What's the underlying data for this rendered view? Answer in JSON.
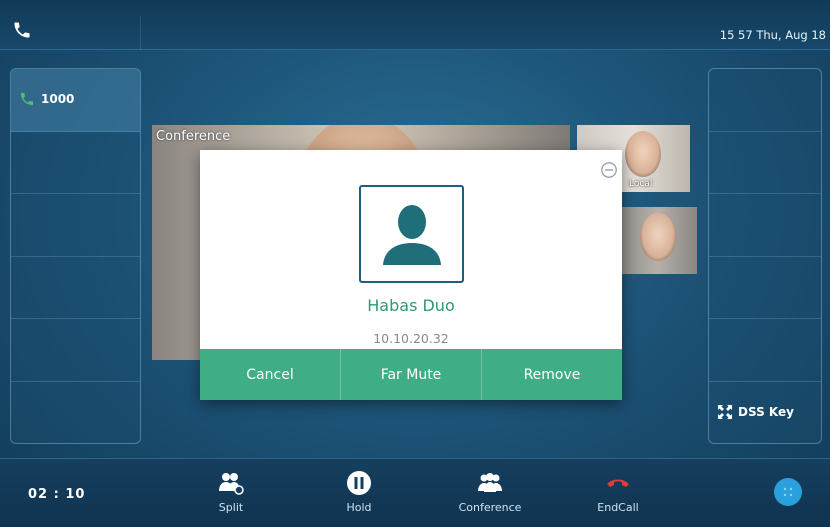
{
  "status_bar": {
    "clock": "15 57 Thu, Aug 18",
    "phone_icon": "phone-icon"
  },
  "line_keys": [
    {
      "label": "1000",
      "icon": "phone-icon",
      "active": true
    },
    {
      "label": ""
    },
    {
      "label": ""
    },
    {
      "label": ""
    },
    {
      "label": ""
    },
    {
      "label": ""
    }
  ],
  "dss_panel": {
    "dss_key_label": "DSS Key",
    "icon": "expand-icon"
  },
  "conference": {
    "video_label": "Conference",
    "thumbnails": [
      {
        "label": "Local"
      },
      {
        "label": ""
      }
    ]
  },
  "dialog": {
    "contact_name": "Habas Duo",
    "contact_ip": "10.10.20.32",
    "actions": [
      "Cancel",
      "Far Mute",
      "Remove"
    ],
    "accent_color": "#3fae85"
  },
  "bottom_bar": {
    "call_timer": "02 : 10",
    "softkeys": [
      {
        "label": "Split",
        "icon": "split-icon"
      },
      {
        "label": "Hold",
        "icon": "hold-icon"
      },
      {
        "label": "Conference",
        "icon": "conference-icon"
      },
      {
        "label": "EndCall",
        "icon": "end-call-icon",
        "color": "#e23b3b"
      }
    ],
    "menu_icon": "more-icon"
  }
}
